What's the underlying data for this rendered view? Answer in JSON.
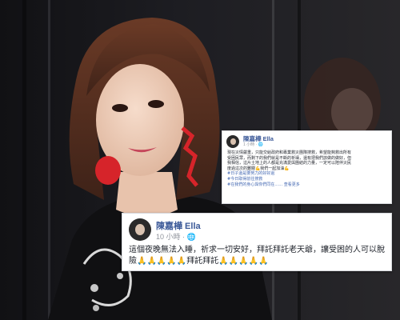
{
  "post_small": {
    "name": "陳嘉樺 Ella",
    "time": "1 小時 · ",
    "text_line1": "現在災情嚴重，只能交給政府和專業救災團隊搜救，希望能夠救出所有",
    "text_line2": "受困民眾，而剩下的我們就是不斷的祈禱，還有把我們該做的做好，但",
    "text_line3": "我相信，這片土地上的人都是充滿愛與團結的力量，一定可以陪伴災民",
    "text_line4": "度過這次的難關💪我們一起加油💪",
    "tag1": "#日子還是要努力的好好過",
    "tag2": "#今日取得前往搜救",
    "tag3": "#在我們的身心與你們同在……",
    "more": "查看更多"
  },
  "post_big": {
    "name": "陳嘉樺 Ella",
    "time": "10 小時 · ",
    "text": "這個夜晚無法入睡，祈求一切安好，拜託拜託老天爺，讓受困的人可以脫險🙏🙏🙏🙏🙏拜託拜託🙏🙏🙏🙏🙏"
  },
  "colors": {
    "name_blue": "#3b5998",
    "link_blue": "#4267b2",
    "background": "#1d1d20"
  }
}
